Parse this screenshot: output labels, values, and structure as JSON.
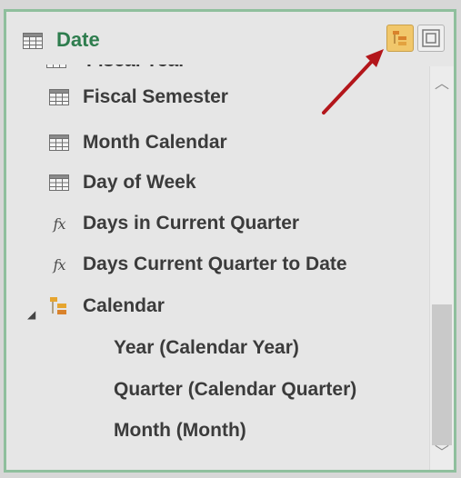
{
  "header": {
    "title": "Date",
    "icons": [
      "table-icon",
      "hierarchy-view-button",
      "frame-view-button"
    ]
  },
  "partial_item": {
    "label": "Fiscal Year",
    "icon": "table-icon"
  },
  "fields": [
    {
      "label": "Fiscal Semester",
      "icon": "table-icon"
    },
    {
      "label": "Month Calendar",
      "icon": "table-icon"
    },
    {
      "label": "Day of Week",
      "icon": "table-icon"
    },
    {
      "label": "Days in Current Quarter",
      "icon": "measure-icon",
      "icon_text": "fx"
    },
    {
      "label": "Days Current Quarter to Date",
      "icon": "measure-icon",
      "icon_text": "fx"
    }
  ],
  "hierarchy": {
    "label": "Calendar",
    "expanded": true,
    "levels": [
      {
        "label": "Year (Calendar Year)"
      },
      {
        "label": "Quarter (Calendar Quarter)"
      },
      {
        "label": "Month (Month)"
      }
    ]
  },
  "colors": {
    "title": "#2e7d4e",
    "panel_border": "#8fbf9d",
    "arrow": "#b3161b",
    "active_button": "#f1c76b"
  }
}
